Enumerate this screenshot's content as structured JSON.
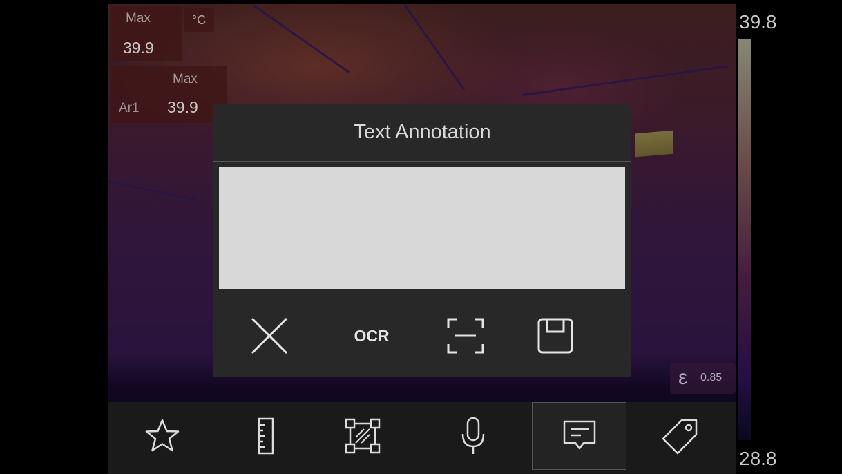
{
  "measurement": {
    "max_box": {
      "label": "Max",
      "value": "39.9"
    },
    "unit": "°C",
    "area": {
      "label": "Max",
      "name": "Ar1",
      "value": "39.9"
    }
  },
  "scale": {
    "max": "39.8",
    "min": "28.8"
  },
  "emissivity": {
    "symbol": "ε",
    "value": "0.85"
  },
  "dialog": {
    "title": "Text Annotation",
    "text_value": "",
    "buttons": {
      "close_icon": "close-icon",
      "ocr_label": "OCR",
      "scan_icon": "scan-icon",
      "save_icon": "save-icon"
    }
  },
  "toolbar": {
    "items": [
      {
        "icon": "star-icon",
        "active": false
      },
      {
        "icon": "ruler-icon",
        "active": false
      },
      {
        "icon": "area-select-icon",
        "active": false
      },
      {
        "icon": "microphone-icon",
        "active": false
      },
      {
        "icon": "text-message-icon",
        "active": true
      },
      {
        "icon": "tag-icon",
        "active": false
      }
    ]
  },
  "colors": {
    "dialog_bg": "#282828",
    "text_area_bg": "#d8d8d8",
    "toolbar_bg": "#1a1a1a",
    "icon": "#dcdcdc"
  }
}
